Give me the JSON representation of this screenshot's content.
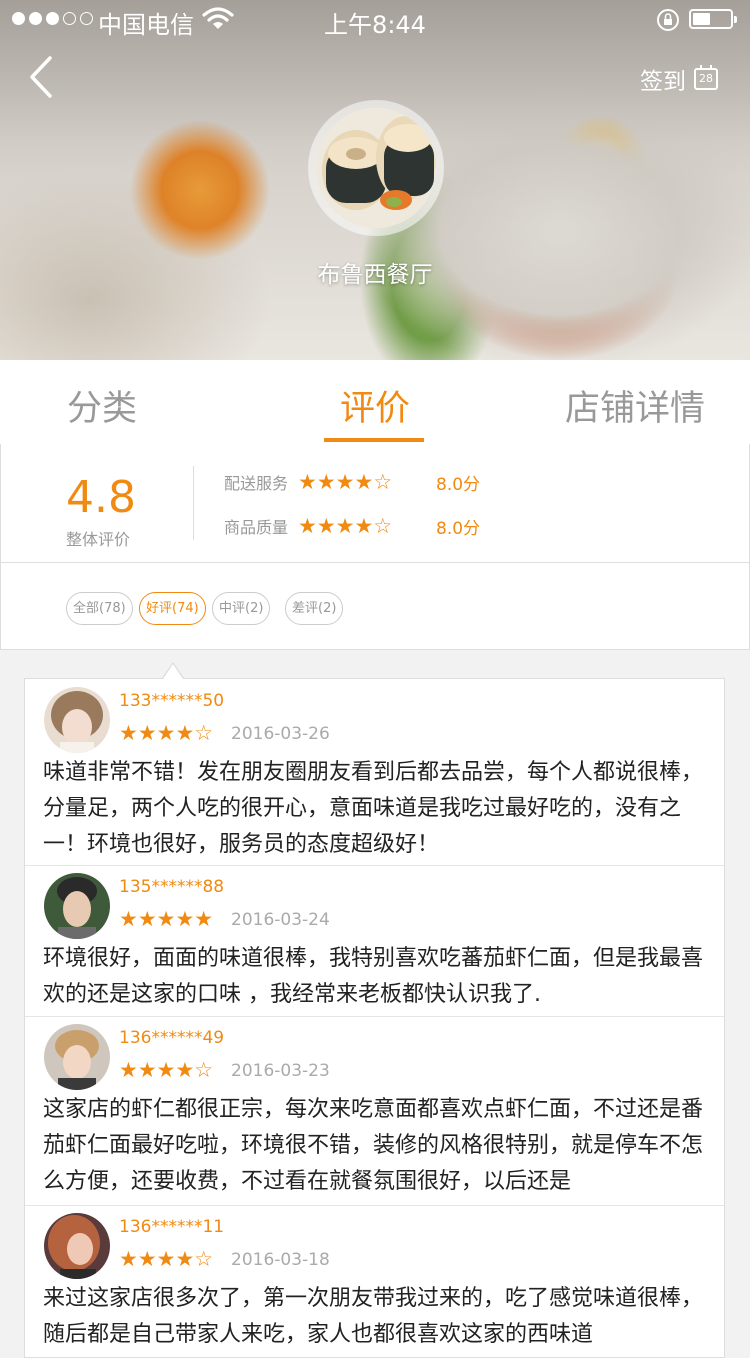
{
  "status_bar": {
    "carrier": "中国电信",
    "time": "上午8:44"
  },
  "header": {
    "checkin_label": "签到",
    "calendar_day": "28",
    "shop_name": "布鲁西餐厅"
  },
  "tabs": [
    {
      "label": "分类",
      "active": false
    },
    {
      "label": "评价",
      "active": true
    },
    {
      "label": "店铺详情",
      "active": false
    }
  ],
  "rating": {
    "overall": "4.8",
    "overall_label": "整体评价",
    "criteria": [
      {
        "label": "配送服务",
        "stars": 4,
        "star_text": "★★★★☆",
        "value": "8.0分"
      },
      {
        "label": "商品质量",
        "stars": 4,
        "star_text": "★★★★☆",
        "value": "8.0分"
      }
    ]
  },
  "filters": [
    {
      "label": "全部(78)",
      "active": false
    },
    {
      "label": "好评(74)",
      "active": true
    },
    {
      "label": "中评(2)",
      "active": false
    },
    {
      "label": "差评(2)",
      "active": false
    }
  ],
  "reviews": [
    {
      "user": "133******50",
      "stars": 4,
      "star_text": "★★★★☆",
      "date": "2016-03-26",
      "text": "味道非常不错！发在朋友圈朋友看到后都去品尝，每个人都说很棒，分量足，两个人吃的很开心，意面味道是我吃过最好吃的，没有之一！环境也很好，服务员的态度超级好！"
    },
    {
      "user": "135******88",
      "stars": 5,
      "star_text": "★★★★★",
      "date": "2016-03-24",
      "text": "环境很好，面面的味道很棒，我特别喜欢吃蕃茄虾仁面，但是我最喜欢的还是这家的口味 ，我经常来老板都快认识我了."
    },
    {
      "user": "136******49",
      "stars": 4,
      "star_text": "★★★★☆",
      "date": "2016-03-23",
      "text": "这家店的虾仁都很正宗，每次来吃意面都喜欢点虾仁面，不过还是番茄虾仁面最好吃啦，环境很不错，装修的风格很特别，就是停车不怎么方便，还要收费，不过看在就餐氛围很好，以后还是"
    },
    {
      "user": "136******11",
      "stars": 4,
      "star_text": "★★★★☆",
      "date": "2016-03-18",
      "text": "来过这家店很多次了，第一次朋友带我过来的，吃了感觉味道很棒，随后都是自己带家人来吃，家人也都很喜欢这家的西味道"
    }
  ],
  "colors": {
    "accent": "#f08a12",
    "muted": "#999999"
  }
}
